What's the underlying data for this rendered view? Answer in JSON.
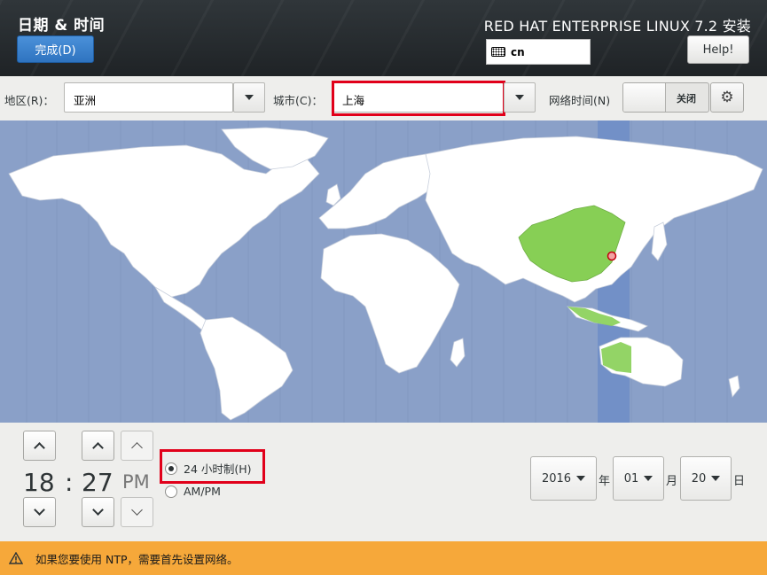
{
  "header": {
    "title": "日期 & 时间",
    "done_label": "完成(D)",
    "product": "RED HAT ENTERPRISE LINUX 7.2 安装",
    "keyboard_layout": "cn",
    "help_label": "Help!"
  },
  "toolbar": {
    "region_label": "地区(R)：",
    "region_value": "亚洲",
    "city_label": "城市(C)：",
    "city_value": "上海",
    "network_time_label": "网络时间(N)",
    "network_time_state": "关闭"
  },
  "map": {
    "highlight_color": "#87cf55",
    "selected_city": "上海",
    "timezone_band_color": "#7290c7"
  },
  "time": {
    "hours": "18",
    "separator": ":",
    "minutes": "27",
    "period": "PM",
    "format_24h_label": "24 小时制(H)",
    "format_ampm_label": "AM/PM",
    "format_selected": "24h"
  },
  "date": {
    "year": "2016",
    "year_unit": "年",
    "month": "01",
    "month_unit": "月",
    "day": "20",
    "day_unit": "日"
  },
  "warning": {
    "text": "如果您要使用 NTP，需要首先设置网络。",
    "icon": "warning-icon"
  }
}
